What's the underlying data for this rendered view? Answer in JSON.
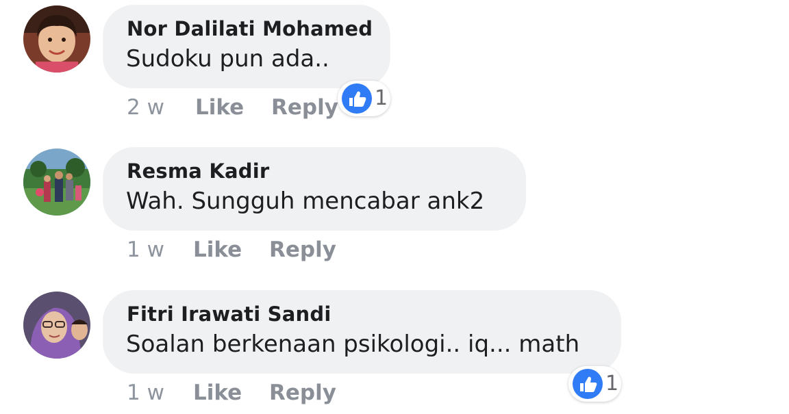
{
  "comments": [
    {
      "author": "Nor Dalilati Mohamed",
      "text": "Sudoku pun ada..",
      "time": "2 w",
      "like_label": "Like",
      "reply_label": "Reply",
      "reaction_count": "1"
    },
    {
      "author": "Resma Kadir",
      "text": "Wah. Sungguh mencabar ank2",
      "time": "1 w",
      "like_label": "Like",
      "reply_label": "Reply"
    },
    {
      "author": "Fitri Irawati Sandi",
      "text": "Soalan berkenaan psikologi.. iq... math",
      "time": "1 w",
      "like_label": "Like",
      "reply_label": "Reply",
      "reaction_count": "1"
    }
  ],
  "colors": {
    "bubble": "#f0f1f3",
    "like_blue": "#2f7cf6",
    "meta_text": "#8d949e"
  },
  "icons": {
    "reaction": "thumbs-up-icon"
  }
}
